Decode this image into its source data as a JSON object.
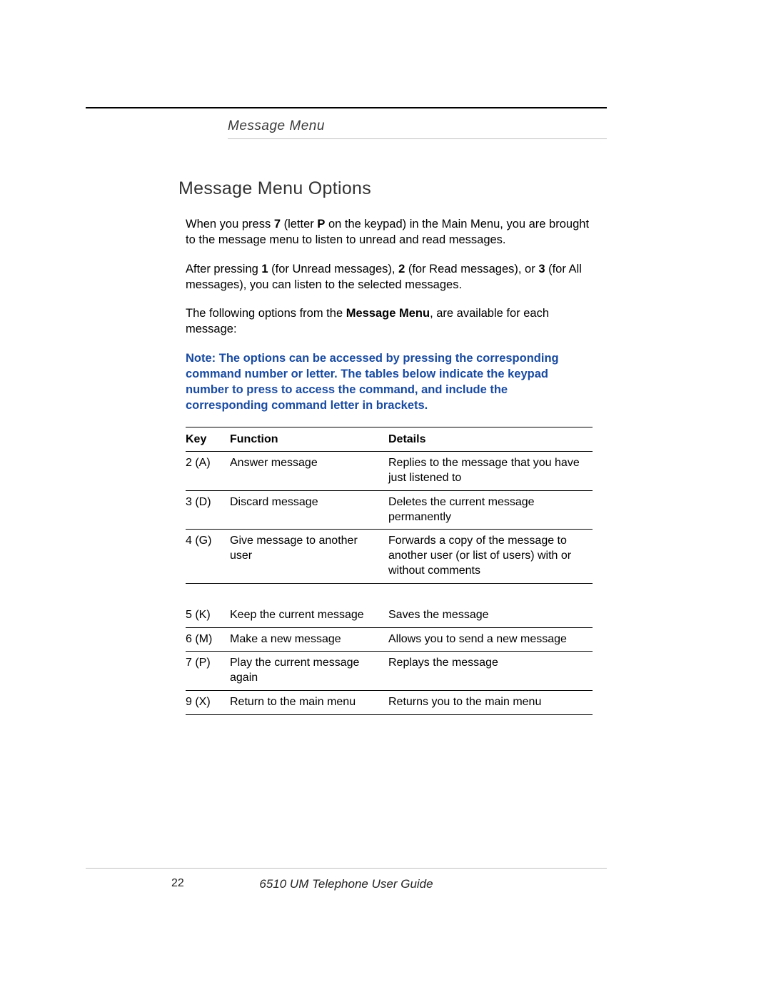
{
  "header": {
    "section_title": "Message Menu"
  },
  "heading": "Message Menu Options",
  "para1": {
    "t1": "When you press ",
    "b1": "7",
    "t2": " (letter ",
    "b2": "P",
    "t3": " on the keypad) in the Main Menu, you are brought to the message menu to listen to unread and read messages."
  },
  "para2": {
    "t1": "After pressing ",
    "b1": "1",
    "t2": " (for Unread messages), ",
    "b2": "2",
    "t3": " (for Read messages), or ",
    "b3": "3",
    "t4": " (for All messages), you can listen to the selected messages."
  },
  "para3": {
    "t1": "The following options from the ",
    "b1": "Message Menu",
    "t2": ", are available for each message:"
  },
  "note": "Note: The options can be accessed by pressing the corresponding command number or letter. The tables below indicate the keypad number to press to access the command, and include the corresponding command letter in brackets.",
  "table": {
    "headers": {
      "key": "Key",
      "func": "Function",
      "details": "Details"
    },
    "rows": [
      {
        "key": "2 (A)",
        "func": "Answer message",
        "details": "Replies to the message that you have just listened to"
      },
      {
        "key": "3 (D)",
        "func": "Discard message",
        "details": "Deletes the current message permanently"
      },
      {
        "key": "4 (G)",
        "func": "Give message to another user",
        "details": "Forwards a copy of the message to another user (or list of users) with or without comments"
      },
      {
        "key": "5 (K)",
        "func": "Keep the current message",
        "details": "Saves the message"
      },
      {
        "key": "6 (M)",
        "func": "Make a new message",
        "details": "Allows you to send a new message"
      },
      {
        "key": "7 (P)",
        "func": "Play the current message again",
        "details": "Replays the message"
      },
      {
        "key": "9 (X)",
        "func": "Return to the main menu",
        "details": "Returns you to the main menu"
      }
    ]
  },
  "footer": {
    "page_number": "22",
    "doc_title": "6510 UM Telephone User Guide"
  }
}
